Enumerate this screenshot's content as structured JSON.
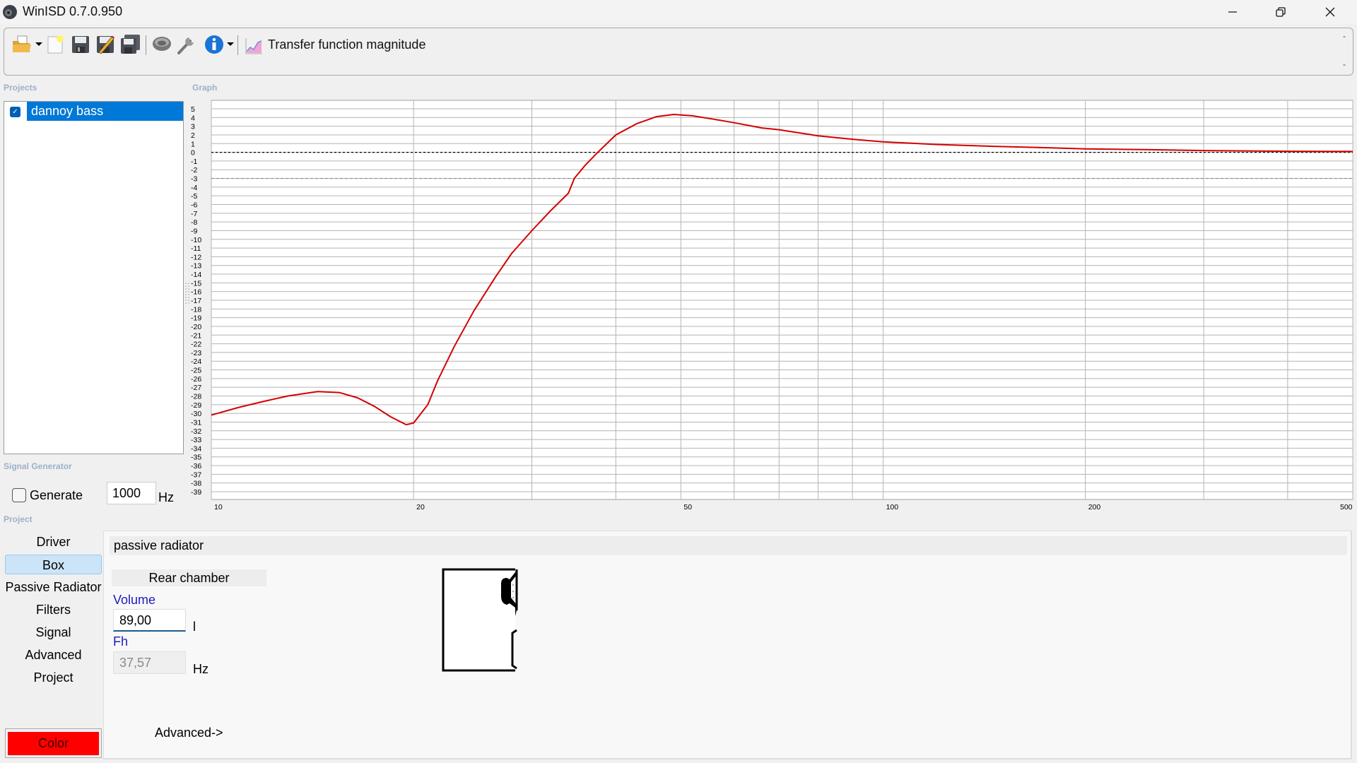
{
  "window": {
    "title": "WinISD 0.7.0.950",
    "app_icon": "speaker-icon",
    "controls": [
      "minimize",
      "restore",
      "close"
    ]
  },
  "toolbar": {
    "icons": [
      "open-folder-icon",
      "new-project-icon",
      "save-icon",
      "save-as-icon",
      "save-all-icon",
      "driver-editor-icon",
      "tools-wrench-icon",
      "info-icon"
    ],
    "graph_selector_label": "Transfer function magnitude",
    "graph_selector_icon": "chart-icon",
    "collapse_marks": [
      "-",
      "-"
    ]
  },
  "projects": {
    "group_label": "Projects",
    "items": [
      {
        "name": "dannoy bass",
        "checked": true,
        "selected": true
      }
    ]
  },
  "graph": {
    "group_label": "Graph"
  },
  "signal_generator": {
    "group_label": "Signal Generator",
    "generate_label": "Generate",
    "generate_checked": false,
    "frequency": "1000",
    "unit": "Hz"
  },
  "project_nav": {
    "group_label": "Project",
    "items": [
      {
        "label": "Driver",
        "active": false
      },
      {
        "label": "Box",
        "active": true
      },
      {
        "label": "Passive Radiator",
        "active": false
      },
      {
        "label": "Filters",
        "active": false
      },
      {
        "label": "Signal",
        "active": false
      },
      {
        "label": "Advanced",
        "active": false
      },
      {
        "label": "Project",
        "active": false
      }
    ],
    "color_button_label": "Color",
    "color_value": "#ff0000"
  },
  "box_panel": {
    "header": "passive radiator",
    "section_label": "Rear chamber",
    "volume_label": "Volume",
    "volume_value": "89,00",
    "volume_unit": "l",
    "fh_label": "Fh",
    "fh_value": "37,57",
    "fh_unit": "Hz",
    "advanced_link": "Advanced->"
  },
  "chart_data": {
    "type": "line",
    "title": "Transfer function magnitude",
    "xlabel": "",
    "ylabel": "",
    "xscale": "log",
    "xlim": [
      10,
      500
    ],
    "ylim": [
      -39,
      5
    ],
    "x_tick_labels": [
      "10",
      "20",
      "50",
      "100",
      "200",
      "500"
    ],
    "x_tick_values": [
      10,
      20,
      50,
      100,
      200,
      500
    ],
    "x_grid_values": [
      10,
      20,
      30,
      40,
      50,
      60,
      70,
      80,
      90,
      100,
      200,
      300,
      400,
      500
    ],
    "y_tick_values": [
      5,
      4,
      3,
      2,
      1,
      0,
      -1,
      -2,
      -3,
      -4,
      -5,
      -6,
      -7,
      -8,
      -9,
      -10,
      -11,
      -12,
      -13,
      -14,
      -15,
      -16,
      -17,
      -18,
      -19,
      -20,
      -21,
      -22,
      -23,
      -24,
      -25,
      -26,
      -27,
      -28,
      -29,
      -30,
      -31,
      -32,
      -33,
      -34,
      -35,
      -36,
      -37,
      -38,
      -39
    ],
    "grid": true,
    "reference_lines": [
      {
        "y": 0,
        "style": "dotted",
        "color": "#000000"
      },
      {
        "y": -3,
        "style": "dashed",
        "color": "#888888"
      }
    ],
    "series": [
      {
        "name": "dannoy bass",
        "color": "#d40000",
        "x": [
          10,
          11,
          12,
          13,
          14.4,
          15.5,
          16.5,
          17.5,
          18.5,
          19.5,
          20,
          21,
          21.7,
          23,
          24.6,
          26.5,
          28,
          30,
          32,
          34,
          34.7,
          36,
          37.6,
          40,
          43,
          46,
          48.8,
          52,
          56,
          60,
          66,
          70,
          80,
          90,
          100,
          120,
          144,
          170,
          200,
          250,
          300,
          400,
          500
        ],
        "y": [
          -30.2,
          -29.3,
          -28.6,
          -28.0,
          -27.5,
          -27.6,
          -28.2,
          -29.2,
          -30.4,
          -31.3,
          -31.1,
          -29.0,
          -26.3,
          -22.3,
          -18.2,
          -14.3,
          -11.6,
          -9.0,
          -6.7,
          -4.7,
          -3.0,
          -1.5,
          0.0,
          2.0,
          3.3,
          4.1,
          4.35,
          4.2,
          3.8,
          3.4,
          2.8,
          2.6,
          1.9,
          1.5,
          1.2,
          0.9,
          0.7,
          0.55,
          0.4,
          0.3,
          0.2,
          0.12,
          0.1
        ]
      }
    ],
    "legend": "none"
  }
}
